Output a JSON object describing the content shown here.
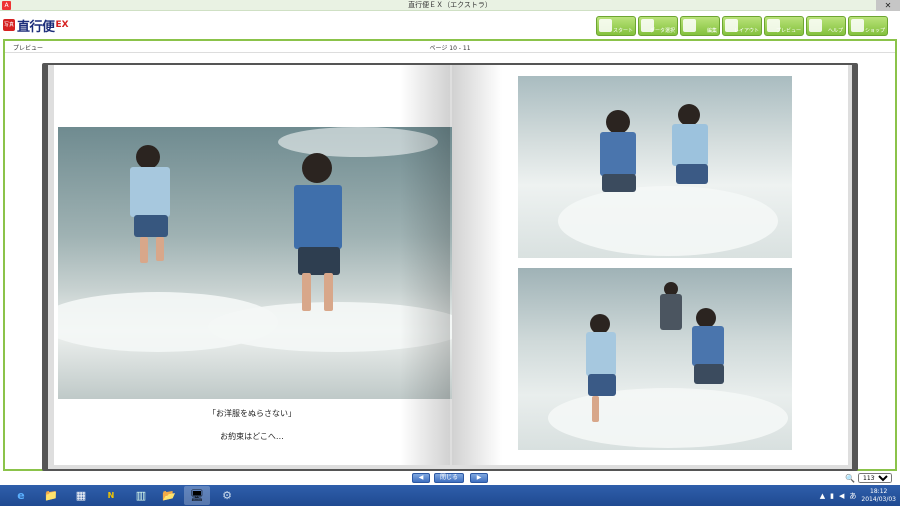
{
  "window": {
    "title": "直行便ＥＸ（エクストラ）",
    "close_glyph": "✕"
  },
  "logo": {
    "mark_text": "写真",
    "name": "直行便",
    "suffix": "EX"
  },
  "toolbar": {
    "buttons": [
      {
        "label": "スタート",
        "icon": "home-icon"
      },
      {
        "label": "データ選択",
        "icon": "data-icon"
      },
      {
        "label": "編集",
        "icon": "edit-icon"
      },
      {
        "label": "レイアウト",
        "icon": "layout-icon"
      },
      {
        "label": "プレビュー",
        "icon": "preview-icon"
      },
      {
        "label": "ヘルプ",
        "icon": "help-icon"
      },
      {
        "label": "ショップ",
        "icon": "shop-icon"
      }
    ]
  },
  "subheader": {
    "left": "プレビュー",
    "center": "ページ 10 - 11"
  },
  "left_page": {
    "caption_line1": "「お洋服をぬらさない」",
    "caption_line2": "お約束はどこへ…"
  },
  "nav": {
    "prev": "◀",
    "center": "閉じる",
    "next": "▶"
  },
  "zoom": {
    "icon": "magnifier-icon",
    "value": "113%"
  },
  "taskbar": {
    "items": [
      "e",
      "📁",
      "▦",
      "N",
      "▥",
      "📂",
      "🖥",
      "⚙"
    ],
    "tray": {
      "ime": "あ",
      "time": "18:12",
      "date": "2014/03/03"
    }
  },
  "colors": {
    "accent": "#8bc34a",
    "taskbar": "#1f4a91"
  }
}
